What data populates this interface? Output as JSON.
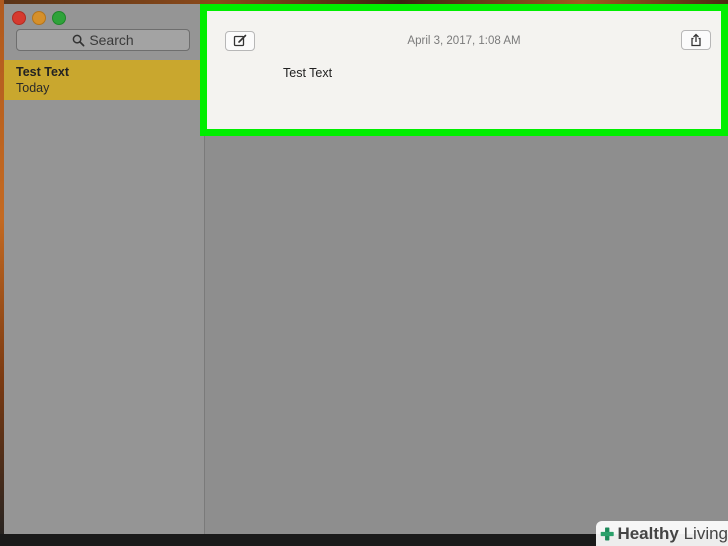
{
  "sidebar": {
    "search_label": "Search",
    "notes": [
      {
        "title": "Test Text",
        "date": "Today"
      }
    ]
  },
  "editor": {
    "timestamp": "April 3, 2017, 1:08 AM",
    "body": "Test Text"
  },
  "watermark": {
    "brand_bold": "Healthy",
    "brand_light": " Living"
  },
  "colors": {
    "highlight": "#00ee00",
    "selected_note": "#c9a72e"
  },
  "icons": [
    "search-icon",
    "compose-icon",
    "share-icon",
    "healthy-living-logo-icon"
  ]
}
